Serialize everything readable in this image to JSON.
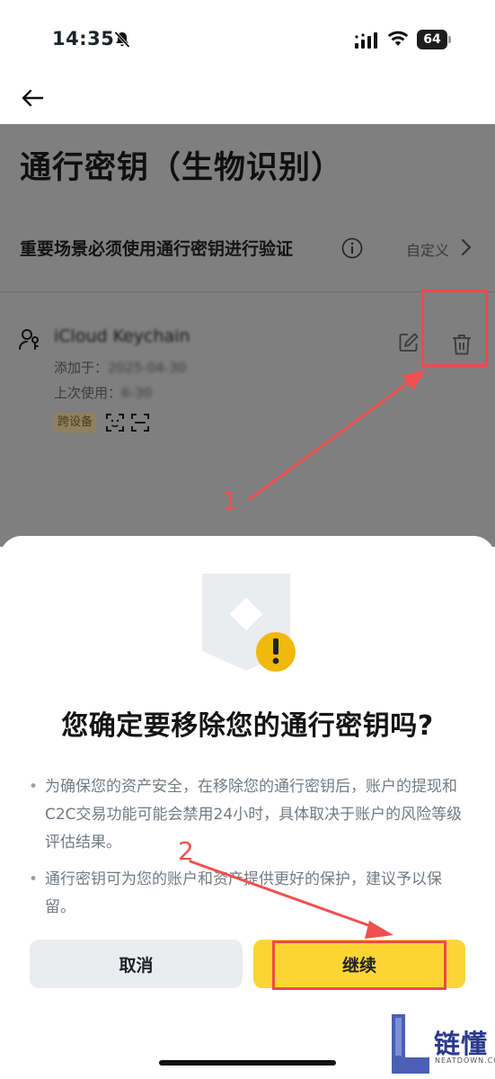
{
  "status_bar": {
    "time": "14:35",
    "battery": "64"
  },
  "page": {
    "title": "通行密钥（生物识别）",
    "scenario_label": "重要场景必须使用通行密钥进行验证",
    "customize_label": "自定义",
    "passkey": {
      "name": "iCloud Keychain",
      "added_label": "添加于：",
      "added_value": "2025-04-30",
      "last_used_label": "上次使用：",
      "last_used_value": "6-30",
      "badge": "跨设备"
    }
  },
  "dialog": {
    "title": "您确定要移除您的通行密钥吗?",
    "bullets": [
      "为确保您的资产安全，在移除您的通行密钥后，账户的提现和C2C交易功能可能会禁用24小时，具体取决于账户的风险等级评估结果。",
      "通行密钥可为您的账户和资产提供更好的保护，建议予以保留。"
    ],
    "cancel_label": "取消",
    "continue_label": "继续"
  },
  "annotations": {
    "step1": "1",
    "step2": "2"
  },
  "watermark": {
    "title": "链懂",
    "subtitle": "NEATDOWN.COM"
  },
  "colors": {
    "accent": "#FCD535",
    "annotation": "#F24848",
    "warning": "#F0B90B"
  }
}
